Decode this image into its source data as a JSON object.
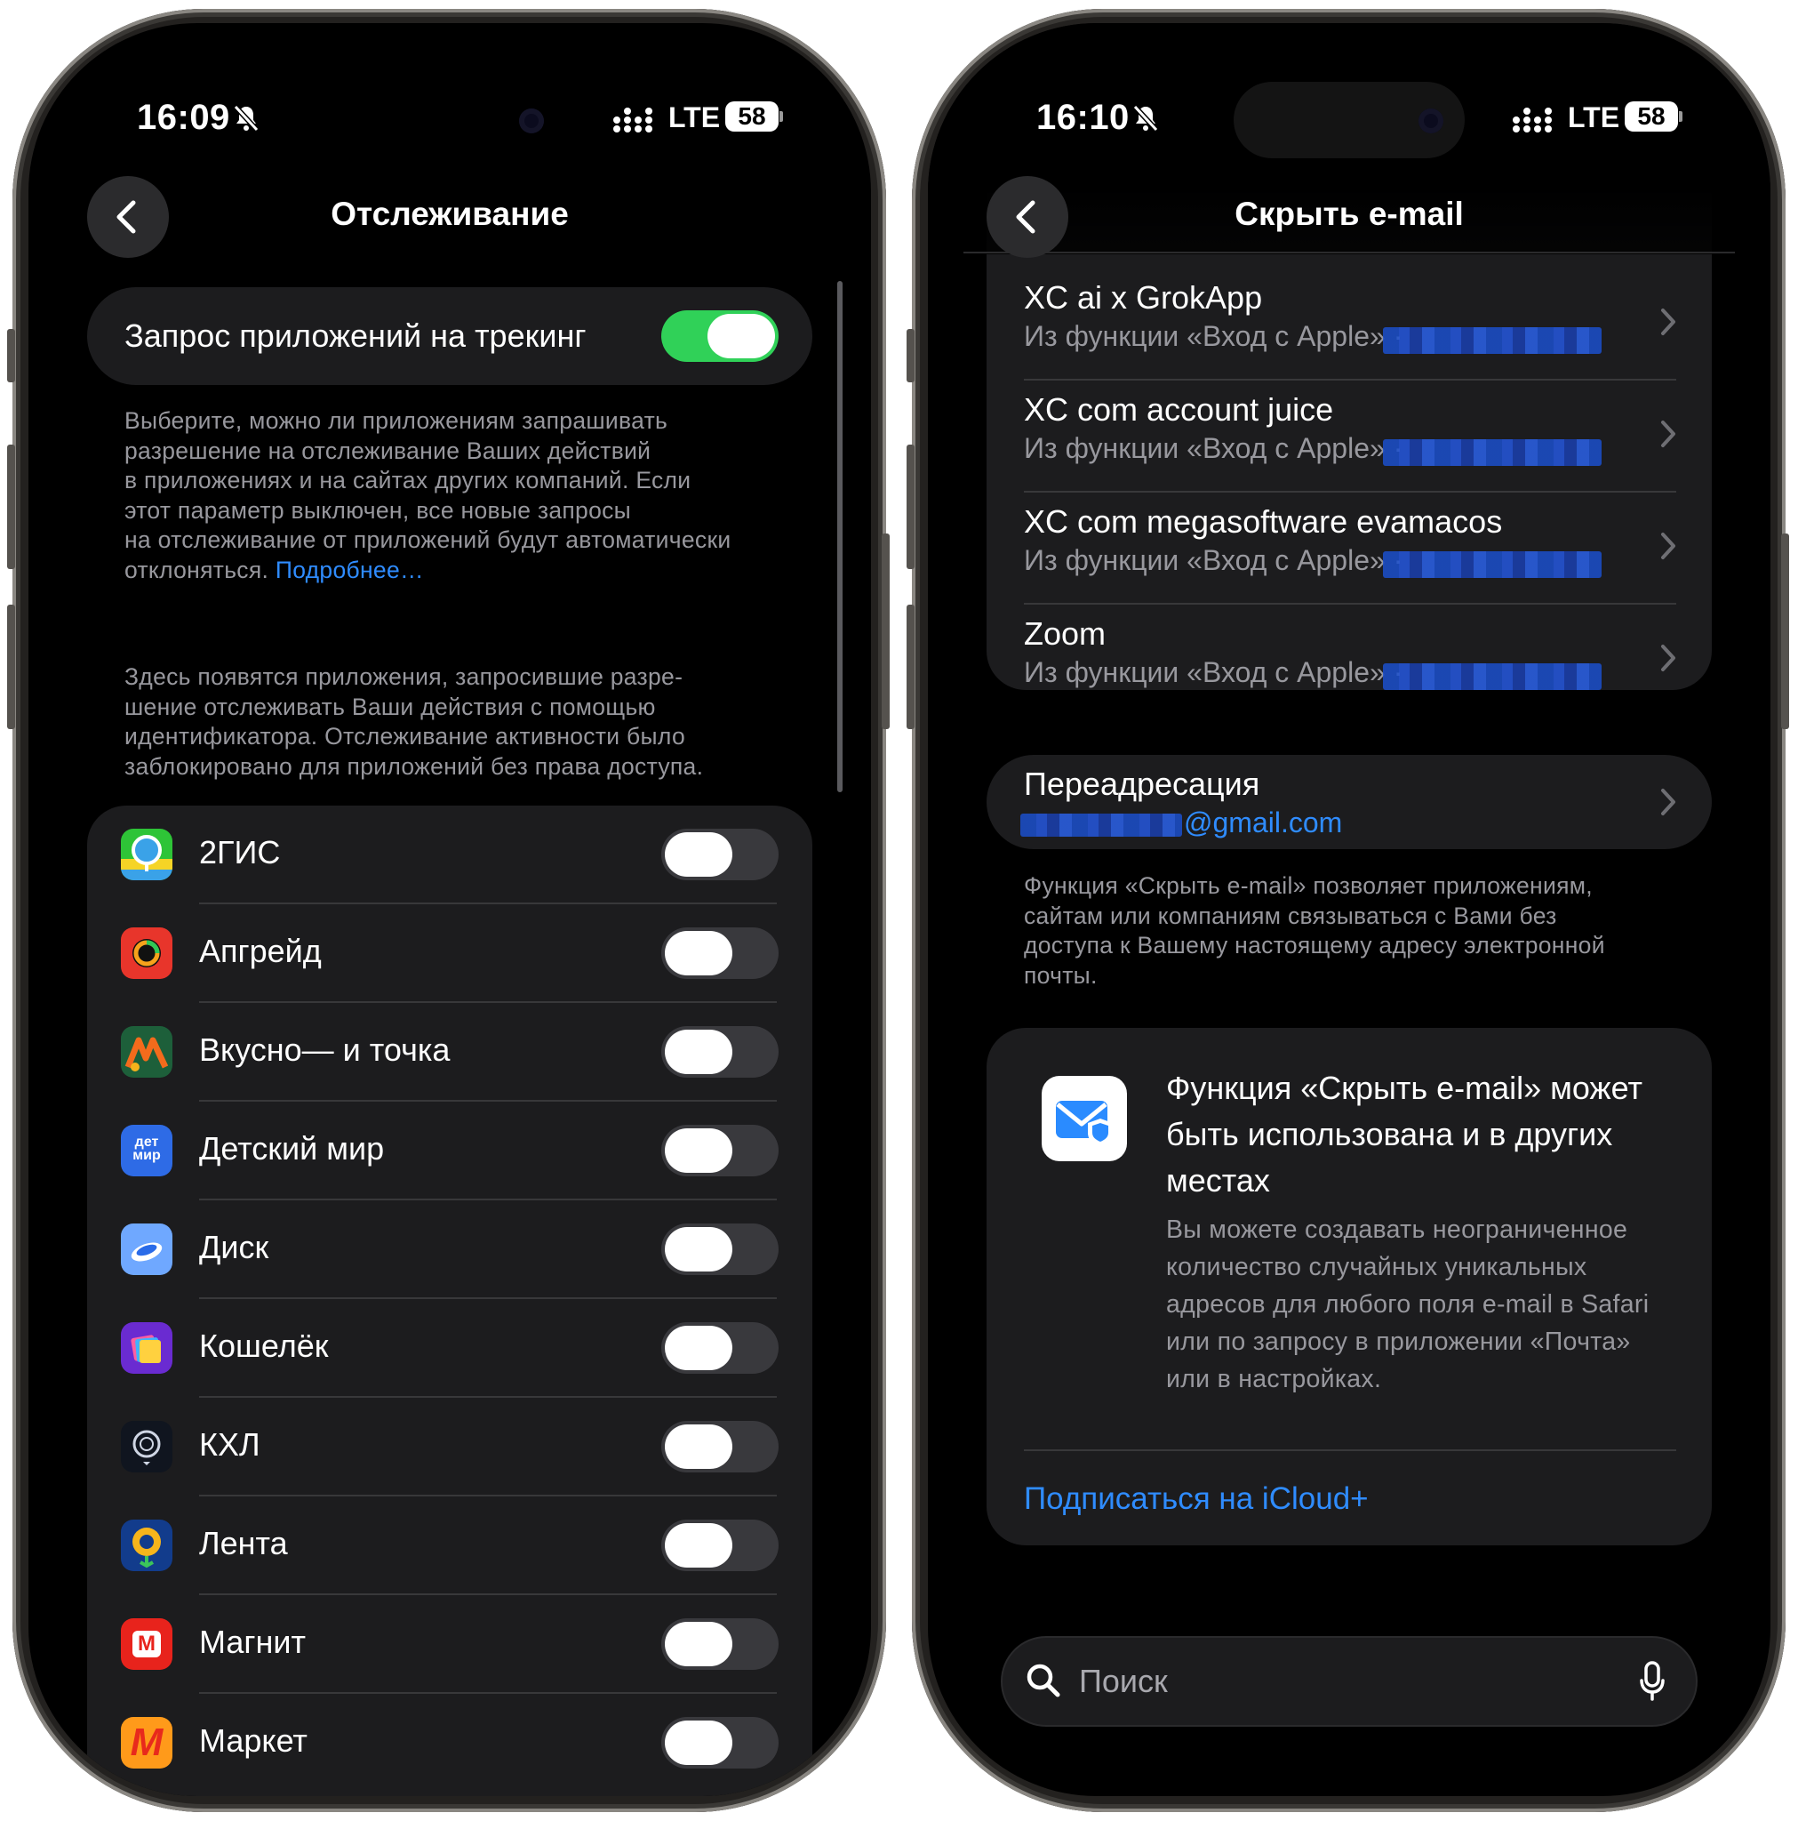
{
  "left_screen": {
    "status": {
      "time": "16:09",
      "network": "LTE",
      "battery": "58"
    },
    "nav": {
      "title": "Отслеживание"
    },
    "tracking_request": {
      "label": "Запрос приложений на трекинг",
      "enabled": true
    },
    "description_1_lines": [
      "Выберите, можно ли приложениям запрашивать",
      "разрешение на отслеживание Ваших действий",
      "в приложениях и на сайтах других компаний. Если",
      "этот параметр выключен, все новые запросы",
      "на отслеживание от приложений будут автоматически"
    ],
    "description_1_last": "отклоняться.",
    "learn_more": "Подробнее…",
    "description_2_lines": [
      "Здесь появятся приложения, запросившие разре-",
      "шение отслеживать Ваши действия с помощью",
      "идентификатора. Отслеживание активности было",
      "заблокировано для приложений без права доступа."
    ],
    "apps": [
      {
        "name": "2ГИС",
        "icon": "2gis-icon",
        "enabled": false
      },
      {
        "name": "Апгрейд",
        "icon": "upgrade-ring-icon",
        "enabled": false
      },
      {
        "name": "Вкусно— и точка",
        "icon": "vkusno-icon",
        "enabled": false
      },
      {
        "name": "Детский мир",
        "icon": "detmir-icon",
        "icon_text": "дет мир",
        "enabled": false
      },
      {
        "name": "Диск",
        "icon": "disk-icon",
        "enabled": false
      },
      {
        "name": "Кошелёк",
        "icon": "wallet-icon",
        "enabled": false
      },
      {
        "name": "КХЛ",
        "icon": "khl-icon",
        "enabled": false
      },
      {
        "name": "Лента",
        "icon": "lenta-sunflower-icon",
        "enabled": false
      },
      {
        "name": "Магнит",
        "icon": "magnit-icon",
        "icon_text": "М",
        "enabled": false
      },
      {
        "name": "Маркет",
        "icon": "market-icon",
        "icon_text": "М",
        "enabled": false
      }
    ]
  },
  "right_screen": {
    "status": {
      "time": "16:10",
      "network": "LTE",
      "battery": "58"
    },
    "nav": {
      "title": "Скрыть e-mail"
    },
    "addresses": [
      {
        "title": "XC ai x GrokApp",
        "subtitle": "Из функции «Вход с Apple» ·"
      },
      {
        "title": "XC com account juice",
        "subtitle": "Из функции «Вход с Apple» ·"
      },
      {
        "title": "XC com megasoftware evamacos",
        "subtitle": "Из функции «Вход с Apple» ·"
      },
      {
        "title": "Zoom",
        "subtitle": "Из функции «Вход с Apple» ·"
      }
    ],
    "forwarding": {
      "title": "Переадресация",
      "email_suffix": "@gmail.com"
    },
    "forwarding_desc_lines": [
      "Функция «Скрыть e-mail» позволяет приложениям,",
      "сайтам или компаниям связываться с Вами без",
      "доступа к Вашему настоящему адресу электронной",
      "почты."
    ],
    "promo": {
      "title_lines": [
        "Функция «Скрыть e-mail» может",
        "быть использована и в других",
        "местах"
      ],
      "body_lines": [
        "Вы можете создавать неограниченное",
        "количество случайных уникальных",
        "адресов для любого поля e-mail в Safari",
        "или по запросу в приложении «Почта»",
        "или в настройках."
      ],
      "link": "Подписаться на iCloud+"
    },
    "search": {
      "placeholder": "Поиск"
    }
  },
  "colors": {
    "background": "#000000",
    "card": "#1c1c1e",
    "accent_blue": "#2f8cff",
    "toggle_on": "#30d158",
    "toggle_off": "#39393d",
    "secondary_text": "#98989e"
  }
}
